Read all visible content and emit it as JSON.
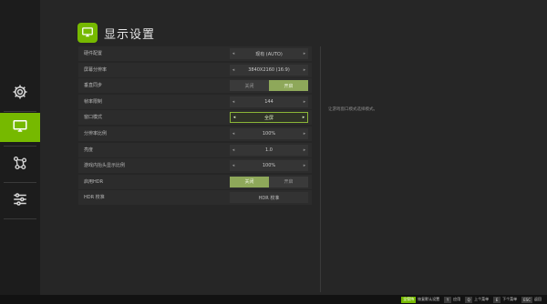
{
  "page": {
    "title": "显示设置",
    "title_icon": "monitor-icon"
  },
  "nav": {
    "items": [
      {
        "icon": "gear-icon",
        "active": false
      },
      {
        "icon": "monitor-icon",
        "active": true
      },
      {
        "icon": "network-icon",
        "active": false
      },
      {
        "icon": "sliders-icon",
        "active": false
      }
    ]
  },
  "settings": {
    "rows": [
      {
        "label": "硬件配置",
        "type": "select",
        "value": "现有 (AUTO)"
      },
      {
        "label": "屏幕分辨率",
        "type": "select",
        "value": "3840X2160 (16:9)"
      },
      {
        "label": "垂直同步",
        "type": "toggle",
        "off_label": "关闭",
        "on_label": "开启",
        "selected": "on"
      },
      {
        "label": "帧率限制",
        "type": "select",
        "value": "144"
      },
      {
        "label": "窗口模式",
        "type": "select",
        "value": "全屏",
        "highlighted": true
      },
      {
        "label": "分辨率比例",
        "type": "select",
        "value": "100%"
      },
      {
        "label": "亮度",
        "type": "select",
        "value": "1.0"
      },
      {
        "label": "游戏内抬头显示比例",
        "type": "select",
        "value": "100%"
      },
      {
        "label": "启用HDR",
        "type": "toggle",
        "off_label": "关闭",
        "on_label": "开启",
        "selected": "off"
      },
      {
        "label": "HDR 校准",
        "type": "button",
        "value": "HDR 校准"
      }
    ]
  },
  "info": {
    "text": "让游戏窗口模式选择模式。"
  },
  "footer": {
    "hints": [
      {
        "key": "",
        "label": "恢复默认设置",
        "key_text": "",
        "green": true,
        "key_label": "全保持"
      },
      {
        "key": "Y",
        "label": "应用"
      },
      {
        "key": "Q",
        "label": "上个菜单"
      },
      {
        "key": "E",
        "label": "下个菜单"
      },
      {
        "key": "ESC",
        "label": "返回"
      }
    ]
  },
  "colors": {
    "accent": "#76b900",
    "background": "#262626",
    "toggle_on": "#8ea85a"
  }
}
